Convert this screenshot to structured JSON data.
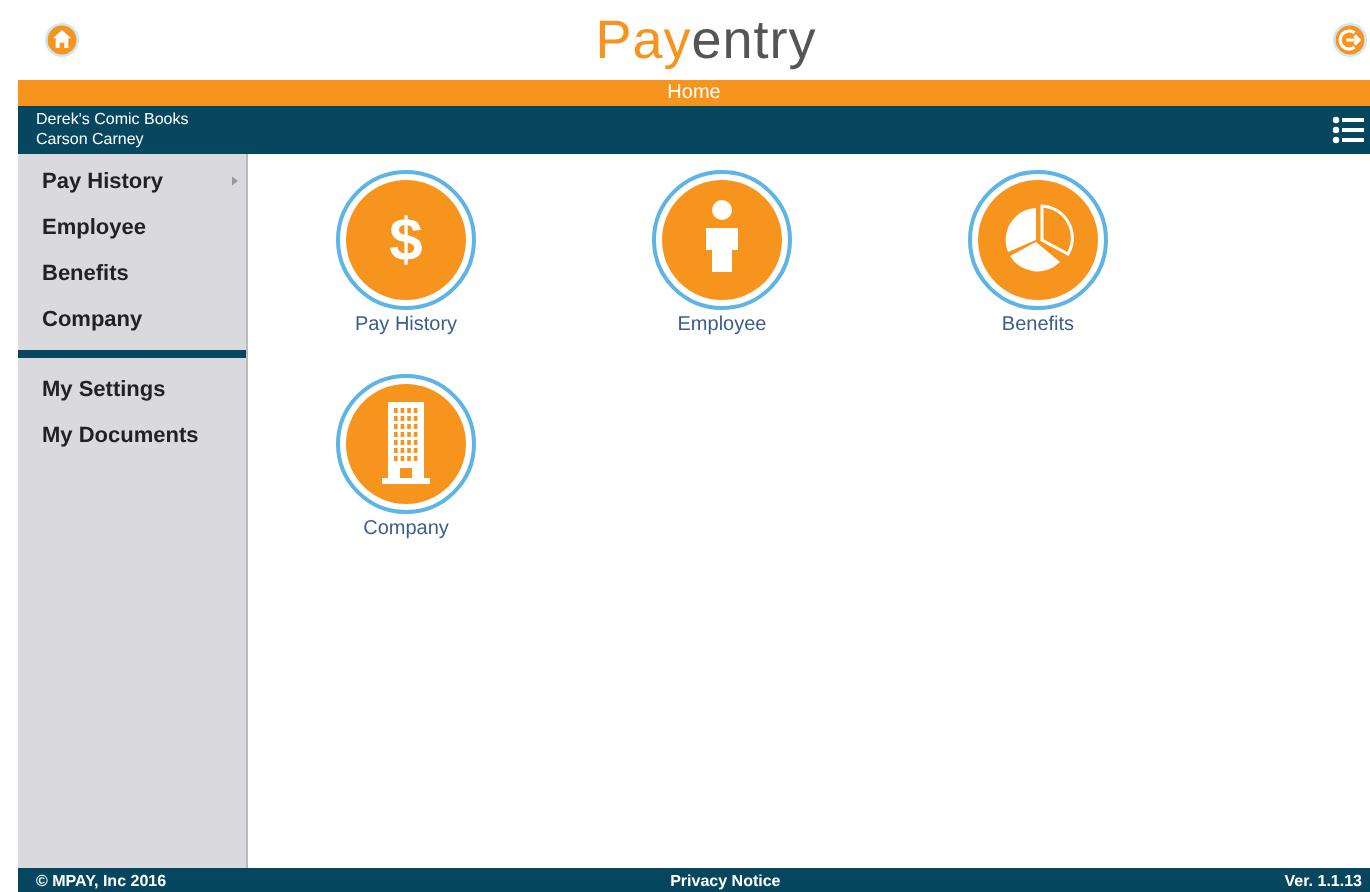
{
  "header": {
    "logo_accent": "Pay",
    "logo_rest": "entry"
  },
  "page_bar": {
    "title": "Home"
  },
  "account_bar": {
    "company": "Derek's Comic Books",
    "user": "Carson Carney"
  },
  "sidebar": {
    "groups": [
      [
        {
          "label": "Pay History",
          "has_submenu": true
        },
        {
          "label": "Employee",
          "has_submenu": false
        },
        {
          "label": "Benefits",
          "has_submenu": false
        },
        {
          "label": "Company",
          "has_submenu": false
        }
      ],
      [
        {
          "label": "My Settings",
          "has_submenu": false
        },
        {
          "label": "My Documents",
          "has_submenu": false
        }
      ]
    ]
  },
  "tiles": [
    {
      "label": "Pay History",
      "kind": "dollar",
      "symbol": "$"
    },
    {
      "label": "Employee",
      "kind": "person"
    },
    {
      "label": "Benefits",
      "kind": "pie"
    },
    {
      "label": "Company",
      "kind": "building"
    }
  ],
  "footer": {
    "copyright": "© MPAY, Inc 2016",
    "link": "Privacy Notice",
    "version": "Ver. 1.1.13"
  }
}
